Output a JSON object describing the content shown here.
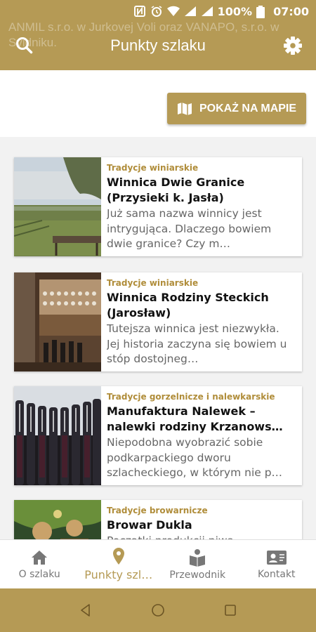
{
  "status_bar": {
    "battery_percent": "100%",
    "time": "07:00"
  },
  "app_bar": {
    "background_text": "ANMIL s.r.o. w Jurkovej Voli oraz VANAPO, s.r.o. w Svidniku.",
    "title": "Punkty szlaku",
    "accent_color": "#b59a55"
  },
  "map_button": {
    "label": "POKAŻ NA MAPIE",
    "icon": "map-icon"
  },
  "cards": [
    {
      "category": "Tradycje winiarskie",
      "title": "Winnica Dwie Granice (Przysieki k. Jasła)",
      "description": "Już sama nazwa winnicy jest intrygująca. Dlaczego bowiem dwie granice? Czy m…"
    },
    {
      "category": "Tradycje winiarskie",
      "title": "Winnica Rodziny Steckich (Jarosław)",
      "description": "Tutejsza winnica jest niezwykła. Jej historia zaczyna się bowiem u stóp dostojneg…"
    },
    {
      "category": "Tradycje gorzelnicze i nalewkarskie",
      "title": "Manufaktura Nalewek – nalewki rodziny Krzanows…",
      "description": "Niepodobna wyobrazić sobie podkarpackiego dworu szlacheckiego, w którym nie p…"
    },
    {
      "category": "Tradycje browarnicze",
      "title": "Browar Dukla",
      "description": "Początki produkcji piwa"
    }
  ],
  "bottom_nav": {
    "items": [
      {
        "label": "O szlaku",
        "icon": "home-icon"
      },
      {
        "label": "Punkty szl…",
        "icon": "location-pin-icon"
      },
      {
        "label": "Przewodnik",
        "icon": "guide-book-icon"
      },
      {
        "label": "Kontakt",
        "icon": "contact-card-icon"
      }
    ],
    "active_index": 1
  }
}
